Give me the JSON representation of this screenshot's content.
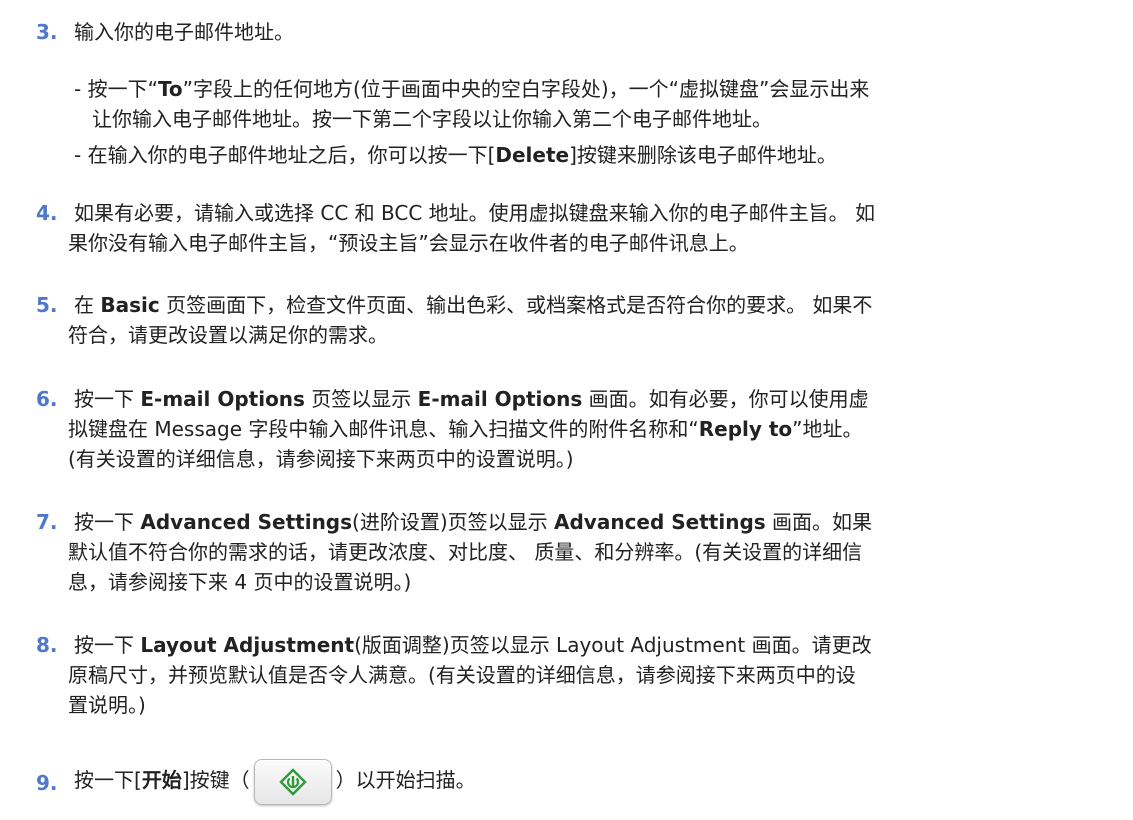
{
  "steps": [
    {
      "num": "3.",
      "text": "输入你的电子邮件地址。"
    },
    {
      "bullets": [
        {
          "l1_pre": "- 按一下“",
          "l1_bold": "To",
          "l1_post": "”字段上的任何地方(位于画面中央的空白字段处)，一个“虚拟键盘”会显示出来",
          "l2": "让你输入电子邮件地址。按一下第二个字段以让你输入第二个电子邮件地址。"
        },
        {
          "pre": "- 在输入你的电子邮件地址之后，你可以按一下[",
          "bold": "Delete",
          "post": "]按键来删除该电子邮件地址。"
        }
      ]
    },
    {
      "num": "4.",
      "l1": "如果有必要，请输入或选择 CC 和 BCC 地址。使用虚拟键盘来输入你的电子邮件主旨。 如",
      "l2": "果你没有输入电子邮件主旨，“预设主旨”会显示在收件者的电子邮件讯息上。"
    },
    {
      "num": "5.",
      "l1_pre": "在 ",
      "l1_bold": "Basic",
      "l1_post": " 页签画面下，检查文件页面、输出色彩、或档案格式是否符合你的要求。 如果不",
      "l2": "符合，请更改设置以满足你的需求。"
    },
    {
      "num": "6.",
      "l1_a": "按一下 ",
      "l1_b": "E-mail Options",
      "l1_c": " 页签以显示 ",
      "l1_d": "E-mail Options",
      "l1_e": " 画面。如有必要，你可以使用虚",
      "l2_a": "拟键盘在 Message 字段中输入邮件讯息、输入扫描文件的附件名称和“",
      "l2_b": "Reply to",
      "l2_c": "”地址。",
      "l3": "(有关设置的详细信息，请参阅接下来两页中的设置说明。)"
    },
    {
      "num": "7.",
      "l1_a": "按一下 ",
      "l1_b": "Advanced Settings",
      "l1_c": "(进阶设置)页签以显示 ",
      "l1_d": "Advanced Settings",
      "l1_e": " 画面。如果",
      "l2": "默认值不符合你的需求的话，请更改浓度、对比度、 质量、和分辨率。(有关设置的详细信",
      "l3": "息，请参阅接下来 4 页中的设置说明。)"
    },
    {
      "num": "8.",
      "l1_a": "按一下 ",
      "l1_b": "Layout Adjustment",
      "l1_c": "(版面调整)页签以显示 Layout Adjustment 画面。请更改",
      "l2": "原稿尺寸，并预览默认值是否令人满意。(有关设置的详细信息，请参阅接下来两页中的设",
      "l3": "置说明。)"
    },
    {
      "num": "9.",
      "pre": "按一下[",
      "bold": "开始",
      "mid": "]按键（",
      "post": "）以开始扫描。"
    }
  ],
  "icons": {
    "start": "start-diamond-icon",
    "color": "#2e9a3e"
  }
}
